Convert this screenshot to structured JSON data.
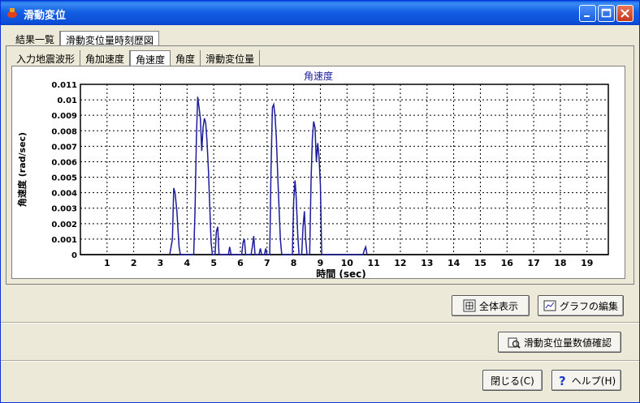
{
  "window": {
    "title": "滑動変位"
  },
  "tabs_top": [
    "結果一覧",
    "滑動変位量時刻歴図"
  ],
  "tabs_sub": [
    "入力地震波形",
    "角加速度",
    "角速度",
    "角度",
    "滑動変位量"
  ],
  "buttons": {
    "show_all": "全体表示",
    "edit_graph": "グラフの編集",
    "check_values": "滑動変位量数値確認",
    "close": "閉じる(C)",
    "help": "ヘルプ(H)"
  },
  "chart_data": {
    "type": "line",
    "title": "角速度",
    "xlabel": "時間 (sec)",
    "ylabel": "角速度 (rad/sec)",
    "xlim": [
      0,
      19.8
    ],
    "ylim": [
      0,
      0.011
    ],
    "xticks": [
      1,
      2,
      3,
      4,
      5,
      6,
      7,
      8,
      9,
      10,
      11,
      12,
      13,
      14,
      15,
      16,
      17,
      18,
      19
    ],
    "yticks": [
      "0",
      "0.001",
      "0.002",
      "0.003",
      "0.004",
      "0.005",
      "0.006",
      "0.007",
      "0.008",
      "0.009",
      "0.01",
      "0.011"
    ],
    "grid": true,
    "series": [
      {
        "color": "#1c1c9c",
        "points": [
          [
            3.35,
            0
          ],
          [
            3.45,
            0.001
          ],
          [
            3.5,
            0.0043
          ],
          [
            3.55,
            0.004
          ],
          [
            3.62,
            0.0028
          ],
          [
            3.7,
            0.0005
          ],
          [
            3.75,
            0
          ],
          [
            4.25,
            0
          ],
          [
            4.3,
            0.003
          ],
          [
            4.35,
            0.0075
          ],
          [
            4.4,
            0.0102
          ],
          [
            4.45,
            0.0095
          ],
          [
            4.5,
            0.0088
          ],
          [
            4.55,
            0.0067
          ],
          [
            4.6,
            0.0082
          ],
          [
            4.65,
            0.0088
          ],
          [
            4.7,
            0.0085
          ],
          [
            4.75,
            0.0073
          ],
          [
            4.8,
            0.0055
          ],
          [
            4.85,
            0.0032
          ],
          [
            4.9,
            0.0008
          ],
          [
            4.95,
            0
          ],
          [
            5.05,
            0
          ],
          [
            5.1,
            0.0015
          ],
          [
            5.15,
            0.0018
          ],
          [
            5.2,
            0
          ],
          [
            5.55,
            0
          ],
          [
            5.6,
            0.0005
          ],
          [
            5.65,
            0
          ],
          [
            6.05,
            0
          ],
          [
            6.1,
            0.0008
          ],
          [
            6.15,
            0.001
          ],
          [
            6.2,
            0
          ],
          [
            6.4,
            0
          ],
          [
            6.45,
            0.0005
          ],
          [
            6.5,
            0.0012
          ],
          [
            6.55,
            0
          ],
          [
            6.7,
            0
          ],
          [
            6.75,
            0.0004
          ],
          [
            6.8,
            0
          ],
          [
            6.9,
            0
          ],
          [
            6.95,
            0.0004
          ],
          [
            7.0,
            0
          ],
          [
            7.1,
            0
          ],
          [
            7.15,
            0.0055
          ],
          [
            7.2,
            0.0095
          ],
          [
            7.25,
            0.0097
          ],
          [
            7.3,
            0.009
          ],
          [
            7.35,
            0.0075
          ],
          [
            7.4,
            0.0052
          ],
          [
            7.45,
            0.003
          ],
          [
            7.5,
            0.001
          ],
          [
            7.55,
            0
          ],
          [
            7.95,
            0
          ],
          [
            8.0,
            0.0035
          ],
          [
            8.05,
            0.0048
          ],
          [
            8.1,
            0.0035
          ],
          [
            8.15,
            0.0013
          ],
          [
            8.2,
            0
          ],
          [
            8.3,
            0
          ],
          [
            8.35,
            0.0018
          ],
          [
            8.4,
            0.0028
          ],
          [
            8.45,
            0.001
          ],
          [
            8.5,
            0
          ],
          [
            8.6,
            0
          ],
          [
            8.65,
            0.0048
          ],
          [
            8.7,
            0.0075
          ],
          [
            8.75,
            0.0086
          ],
          [
            8.8,
            0.0082
          ],
          [
            8.85,
            0.006
          ],
          [
            8.9,
            0.0072
          ],
          [
            8.95,
            0.0063
          ],
          [
            9.0,
            0.0045
          ],
          [
            9.05,
            0
          ],
          [
            10.6,
            0
          ],
          [
            10.65,
            0.0003
          ],
          [
            10.7,
            0.0005
          ],
          [
            10.75,
            0
          ]
        ]
      }
    ]
  }
}
